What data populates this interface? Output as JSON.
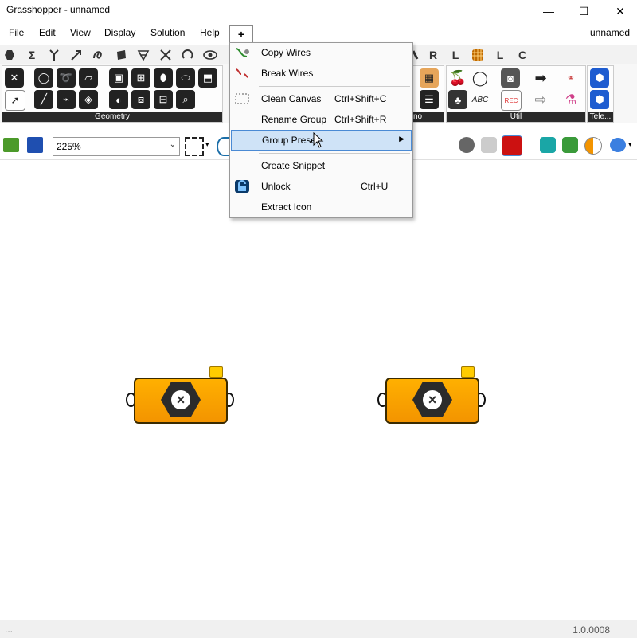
{
  "window": {
    "title": "Grasshopper - unnamed",
    "minimize": "—",
    "maximize": "☐",
    "close": "✕"
  },
  "menubar": {
    "items": [
      "File",
      "Edit",
      "View",
      "Display",
      "Solution",
      "Help"
    ],
    "plus": "+",
    "doc_name": "unnamed"
  },
  "tabstrip": {
    "letters": [
      "Σ",
      "L",
      "L",
      "C"
    ]
  },
  "ribbon": {
    "panels": [
      "Geometry",
      "Util",
      "Tele..."
    ],
    "partial_label": "no",
    "text_icon": "ABC",
    "rec_label": "REC"
  },
  "canvas_toolbar": {
    "zoom": "225%"
  },
  "context_menu": {
    "items": [
      {
        "label": "Copy Wires",
        "shortcut": ""
      },
      {
        "label": "Break Wires",
        "shortcut": ""
      },
      {
        "label": "Clean Canvas",
        "shortcut": "Ctrl+Shift+C"
      },
      {
        "label": "Rename Group",
        "shortcut": "Ctrl+Shift+R"
      },
      {
        "label": "Group Preset",
        "shortcut": ""
      },
      {
        "label": "Create Snippet",
        "shortcut": ""
      },
      {
        "label": "Unlock",
        "shortcut": "Ctrl+U"
      },
      {
        "label": "Extract Icon",
        "shortcut": ""
      }
    ],
    "highlighted": "Group Preset"
  },
  "statusbar": {
    "left": "...",
    "version": "1.0.0008"
  },
  "colors": {
    "component_fill": "#f39400",
    "component_dark": "#2b2b2b",
    "highlight": "#cfe3f7",
    "panel_label_bg": "#2a2a2a"
  }
}
